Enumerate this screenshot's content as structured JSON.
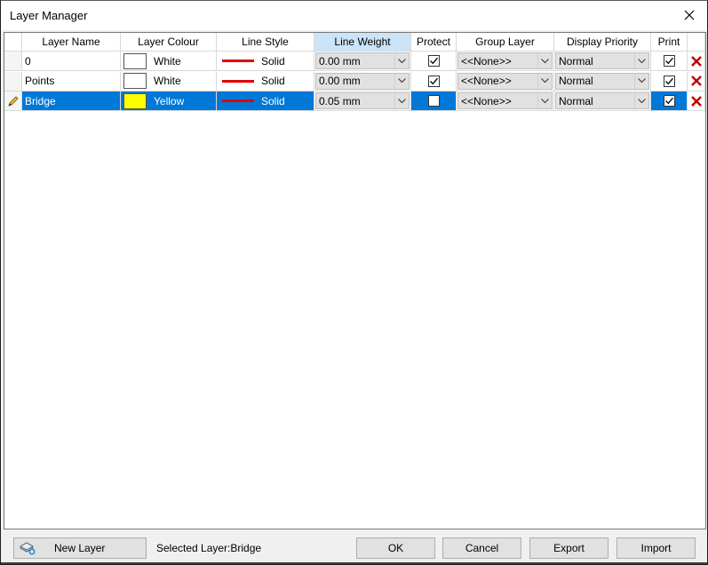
{
  "window": {
    "title": "Layer Manager"
  },
  "grid": {
    "columns": [
      "Layer Name",
      "Layer Colour",
      "Line Style",
      "Line Weight",
      "Protect",
      "Group Layer",
      "Display Priority",
      "Print"
    ],
    "rows": [
      {
        "name": "0",
        "colour_label": "White",
        "colour_hex": "#ffffff",
        "line_style": "Solid",
        "line_weight": "0.00 mm",
        "protect": true,
        "group_layer": "<<None>>",
        "priority": "Normal",
        "print": true,
        "selected": false
      },
      {
        "name": "Points",
        "colour_label": "White",
        "colour_hex": "#ffffff",
        "line_style": "Solid",
        "line_weight": "0.00 mm",
        "protect": true,
        "group_layer": "<<None>>",
        "priority": "Normal",
        "print": true,
        "selected": false
      },
      {
        "name": "Bridge",
        "colour_label": "Yellow",
        "colour_hex": "#ffff00",
        "line_style": "Solid",
        "line_weight": "0.05 mm",
        "protect": false,
        "group_layer": "<<None>>",
        "priority": "Normal",
        "print": true,
        "selected": true
      }
    ]
  },
  "colors": {
    "selection": "#0078d7",
    "line": "#e00000",
    "delete": "#c00000"
  },
  "footer": {
    "new_layer_label": "New Layer",
    "selected_layer_text": "Selected Layer:Bridge",
    "ok_label": "OK",
    "cancel_label": "Cancel",
    "export_label": "Export",
    "import_label": "Import"
  }
}
